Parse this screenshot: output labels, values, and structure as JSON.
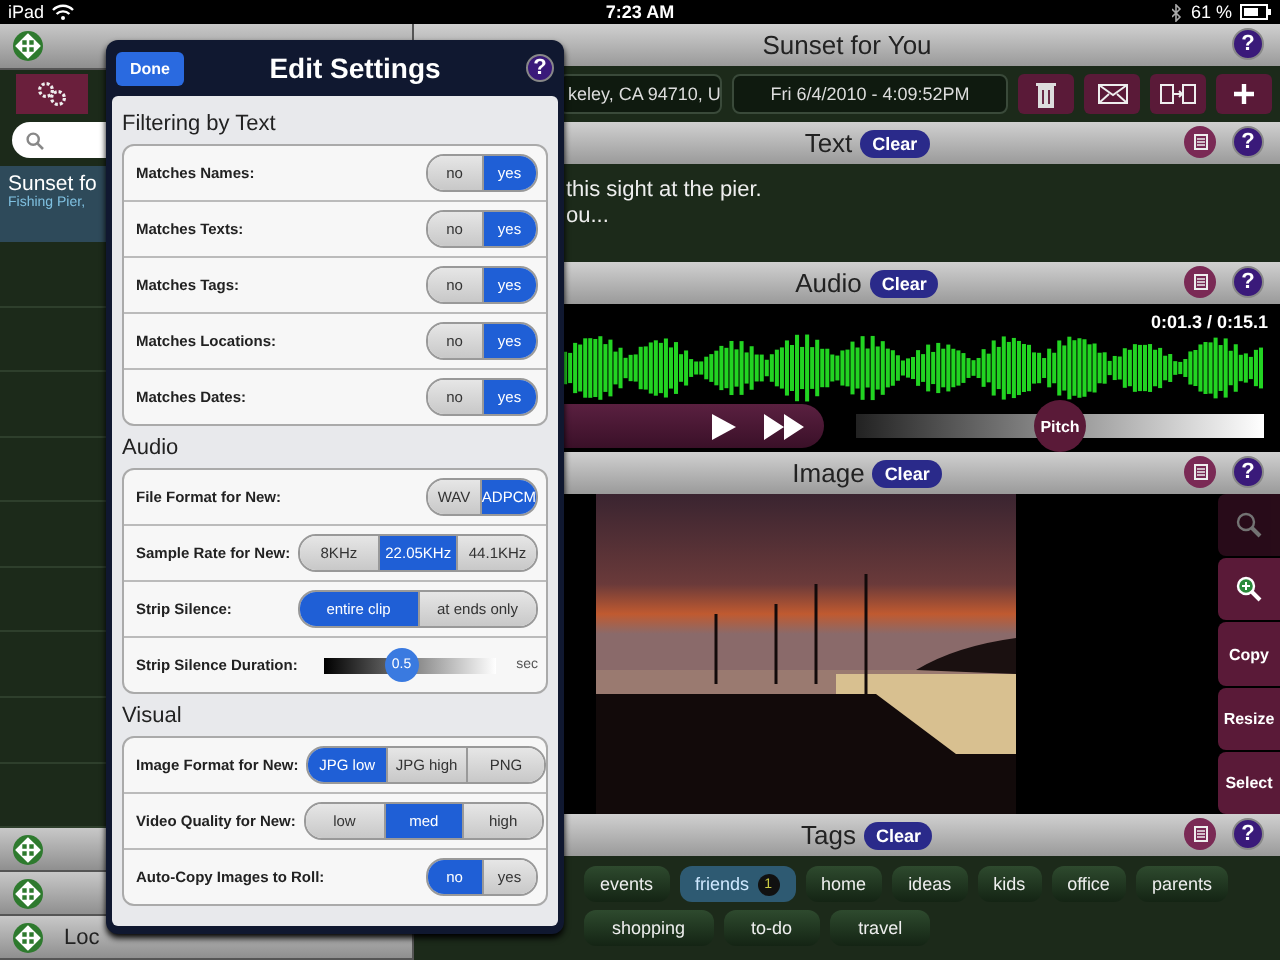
{
  "status_bar": {
    "device": "iPad",
    "time": "7:23 AM",
    "battery": "61 %"
  },
  "sidebar": {
    "items": [
      {
        "title": "Sunset fo",
        "subtitle": "Fishing Pier,",
        "selected": true
      }
    ],
    "bottom_label": "Loc"
  },
  "note": {
    "title": "Sunset for You",
    "help": "?",
    "location": "keley, CA 94710, U",
    "date": "Fri 6/4/2010 - 4:09:52PM"
  },
  "text_panel": {
    "title": "Text",
    "clear": "Clear",
    "help": "?",
    "lines": [
      "this sight at the pier.",
      "ou..."
    ]
  },
  "audio_panel": {
    "title": "Audio",
    "clear": "Clear",
    "help": "?",
    "time": "0:01.3 / 0:15.1",
    "pitch": {
      "label": "Pitch",
      "level": 0.5
    }
  },
  "image_panel": {
    "title": "Image",
    "clear": "Clear",
    "help": "?",
    "tools": [
      {
        "kind": "zoom-out",
        "disabled": true
      },
      {
        "kind": "zoom-in",
        "disabled": false
      },
      {
        "kind": "text",
        "label": "Copy",
        "disabled": false
      },
      {
        "kind": "text",
        "label": "Resize",
        "disabled": false
      },
      {
        "kind": "text",
        "label": "Select",
        "disabled": false
      }
    ]
  },
  "tags_panel": {
    "title": "Tags",
    "clear": "Clear",
    "help": "?",
    "rows": [
      [
        {
          "label": "events",
          "selected": false
        },
        {
          "label": "friends",
          "selected": true,
          "count": "1"
        },
        {
          "label": "home",
          "selected": false
        },
        {
          "label": "ideas",
          "selected": false
        },
        {
          "label": "kids",
          "selected": false
        },
        {
          "label": "office",
          "selected": false
        },
        {
          "label": "parents",
          "selected": false
        }
      ],
      [
        {
          "label": "shopping",
          "selected": false
        },
        {
          "label": "to-do",
          "selected": false
        },
        {
          "label": "travel",
          "selected": false
        }
      ]
    ]
  },
  "popover": {
    "title": "Edit Settings",
    "done": "Done",
    "help": "?",
    "sections": [
      {
        "title": "Filtering by Text",
        "rows": [
          {
            "kind": "segmented",
            "label": "Matches Names:",
            "options": [
              {
                "label": "no",
                "selected": false
              },
              {
                "label": "yes",
                "selected": true
              }
            ]
          },
          {
            "kind": "segmented",
            "label": "Matches Texts:",
            "options": [
              {
                "label": "no",
                "selected": false
              },
              {
                "label": "yes",
                "selected": true
              }
            ]
          },
          {
            "kind": "segmented",
            "label": "Matches Tags:",
            "options": [
              {
                "label": "no",
                "selected": false
              },
              {
                "label": "yes",
                "selected": true
              }
            ]
          },
          {
            "kind": "segmented",
            "label": "Matches Locations:",
            "options": [
              {
                "label": "no",
                "selected": false
              },
              {
                "label": "yes",
                "selected": true
              }
            ]
          },
          {
            "kind": "segmented",
            "label": "Matches Dates:",
            "options": [
              {
                "label": "no",
                "selected": false
              },
              {
                "label": "yes",
                "selected": true
              }
            ]
          }
        ]
      },
      {
        "title": "Audio",
        "rows": [
          {
            "kind": "segmented",
            "label": "File Format for New:",
            "options": [
              {
                "label": "WAV",
                "selected": false
              },
              {
                "label": "ADPCM",
                "selected": true
              }
            ]
          },
          {
            "kind": "segmented",
            "label": "Sample Rate for New:",
            "options": [
              {
                "label": "8KHz",
                "selected": false
              },
              {
                "label": "22.05KHz",
                "selected": true
              },
              {
                "label": "44.1KHz",
                "selected": false
              }
            ]
          },
          {
            "kind": "segmented",
            "label": "Strip Silence:",
            "options": [
              {
                "label": "entire clip",
                "selected": true
              },
              {
                "label": "at ends only",
                "selected": false
              }
            ]
          },
          {
            "kind": "slider",
            "label": "Strip Silence Duration:",
            "level": 0.45,
            "reading": "0.5",
            "unit": "sec"
          }
        ]
      },
      {
        "title": "Visual",
        "rows": [
          {
            "kind": "segmented",
            "label": "Image Format for New:",
            "options": [
              {
                "label": "JPG low",
                "selected": true
              },
              {
                "label": "JPG high",
                "selected": false
              },
              {
                "label": "PNG",
                "selected": false
              }
            ]
          },
          {
            "kind": "segmented",
            "label": "Video Quality for New:",
            "options": [
              {
                "label": "low",
                "selected": false
              },
              {
                "label": "med",
                "selected": true
              },
              {
                "label": "high",
                "selected": false
              }
            ]
          },
          {
            "kind": "segmented",
            "label": "Auto-Copy Images to Roll:",
            "options": [
              {
                "label": "no",
                "selected": true
              },
              {
                "label": "yes",
                "selected": false
              }
            ]
          }
        ]
      }
    ]
  }
}
